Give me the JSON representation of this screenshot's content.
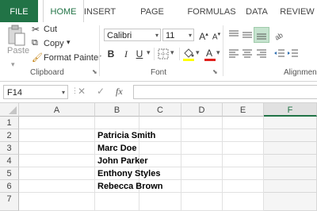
{
  "ribbon_tabs": [
    {
      "label": "FILE"
    },
    {
      "label": "HOME"
    },
    {
      "label": "INSERT"
    },
    {
      "label": "PAGE LAYOUT"
    },
    {
      "label": "FORMULAS"
    },
    {
      "label": "DATA"
    },
    {
      "label": "REVIEW"
    }
  ],
  "clipboard": {
    "paste_label": "Paste",
    "cut_label": "Cut",
    "copy_label": "Copy",
    "format_painter_label": "Format Painter",
    "group_label": "Clipboard"
  },
  "font": {
    "font_name": "Calibri",
    "font_size": "11",
    "grow_label": "A",
    "shrink_label": "A",
    "bold_label": "B",
    "italic_label": "I",
    "underline_label": "U",
    "group_label": "Font"
  },
  "alignment": {
    "group_label": "Alignmen"
  },
  "formula_bar": {
    "name_box": "F14",
    "cancel_symbol": "✕",
    "enter_symbol": "✓",
    "fx_label": "fx",
    "formula": ""
  },
  "sheet": {
    "columns": [
      "A",
      "B",
      "C",
      "D",
      "E",
      "F"
    ],
    "selected_column": "F",
    "rows": [
      "1",
      "2",
      "3",
      "4",
      "5",
      "6",
      "7"
    ],
    "cells": [
      {
        "row": "2",
        "col": "B",
        "value": "Patricia Smith"
      },
      {
        "row": "3",
        "col": "B",
        "value": "Marc Doe"
      },
      {
        "row": "4",
        "col": "B",
        "value": "John Parker"
      },
      {
        "row": "5",
        "col": "B",
        "value": "Enthony Styles"
      },
      {
        "row": "6",
        "col": "B",
        "value": "Rebecca Brown"
      }
    ]
  },
  "colors": {
    "accent": "#217346",
    "font_color_bar": "#e0201b",
    "highlight_bar": "#ffff00"
  }
}
